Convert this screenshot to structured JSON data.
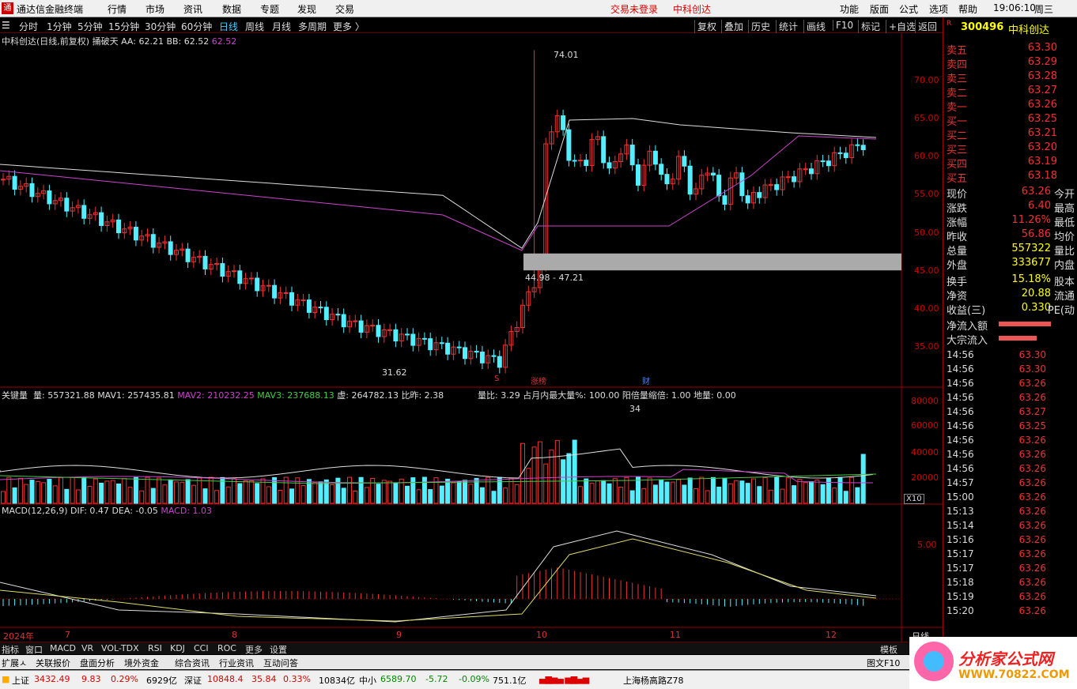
{
  "menu": {
    "app_title": "通达信金融终端",
    "items": [
      "行情",
      "市场",
      "资讯",
      "数据",
      "专题",
      "发现",
      "交易"
    ],
    "login": "交易未登录",
    "stock_name": "中科创达",
    "right_items": [
      "功能",
      "版面",
      "公式",
      "选项",
      "帮助"
    ],
    "time": "19:06:10",
    "weekday": "周三"
  },
  "toolbar": {
    "periods": [
      "分时",
      "1分钟",
      "5分钟",
      "15分钟",
      "30分钟",
      "60分钟",
      "日线",
      "周线",
      "月线",
      "多周期",
      "更多 〉"
    ],
    "active_period": "日线",
    "right_buttons": [
      "复权",
      "叠加",
      "历史",
      "统计",
      "画线",
      "F10",
      "标记",
      "+自选",
      "返回"
    ]
  },
  "main_panel": {
    "title": "中科创达(日线,前复权)",
    "indicator": "捅破天",
    "aa": "AA: 62.21",
    "bb": "BB: 62.52",
    "val": "62.52",
    "y_labels": [
      "70.00",
      "65.00",
      "60.00",
      "55.00",
      "50.00",
      "45.00",
      "40.00",
      "35.00"
    ],
    "high_label": "74.01",
    "low_label": "31.62",
    "gap_label": "44.98 - 47.21",
    "marks": [
      "S",
      "涨榜",
      "财"
    ]
  },
  "volume_panel": {
    "name": "关键量",
    "vol": "量: 557321.88",
    "mav1": "MAV1: 257435.81",
    "mav2": "MAV2: 210232.25",
    "mav3": "MAV3: 237688.13",
    "xu": "虚: 264782.13",
    "bizuo": "比昨: 2.38",
    "liangbi": "量比: 3.29",
    "zhanyue": "占月内最大量%: 100.00",
    "yangbei": "阳倍量缩倍: 1.00",
    "diliang": "地量: 0.00",
    "count": "34",
    "y_labels": [
      "80000",
      "60000",
      "40000",
      "20000"
    ],
    "unit": "X10"
  },
  "macd_panel": {
    "name": "MACD(12,26,9)",
    "dif": "DIF: 0.47",
    "dea": "DEA: -0.05",
    "macd": "MACD: 1.03",
    "y_label": "5.00"
  },
  "xaxis": {
    "labels": [
      "2024年",
      "7",
      "8",
      "9",
      "10",
      "11",
      "12"
    ],
    "period": "日线"
  },
  "quote": {
    "code": "300496",
    "name": "中科创达",
    "sells": [
      [
        "卖五",
        "63.30"
      ],
      [
        "卖四",
        "63.29"
      ],
      [
        "卖三",
        "63.28"
      ],
      [
        "卖二",
        "63.27"
      ],
      [
        "卖一",
        "63.26"
      ]
    ],
    "buys": [
      [
        "买一",
        "63.25"
      ],
      [
        "买二",
        "63.21"
      ],
      [
        "买三",
        "63.20"
      ],
      [
        "买四",
        "63.19"
      ],
      [
        "买五",
        "63.18"
      ]
    ],
    "stats": [
      [
        "现价",
        "63.26",
        "今开"
      ],
      [
        "涨跌",
        "6.40",
        "最高"
      ],
      [
        "涨幅",
        "11.26%",
        "最低"
      ],
      [
        "昨收",
        "56.86",
        "均价"
      ],
      [
        "总量",
        "557322",
        "量比"
      ],
      [
        "外盘",
        "333677",
        "内盘"
      ],
      [
        "换手",
        "15.18%",
        "股本"
      ],
      [
        "净资",
        "20.88",
        "流通"
      ],
      [
        "收益(三)",
        "0.330",
        "PE(动"
      ]
    ],
    "flows": [
      "净流入额",
      "大宗流入"
    ],
    "ticks": [
      [
        "14:56",
        "63.30"
      ],
      [
        "14:56",
        "63.30"
      ],
      [
        "14:56",
        "63.26"
      ],
      [
        "14:56",
        "63.26"
      ],
      [
        "14:56",
        "63.27"
      ],
      [
        "14:56",
        "63.25"
      ],
      [
        "14:56",
        "63.26"
      ],
      [
        "14:56",
        "63.26"
      ],
      [
        "14:56",
        "63.26"
      ],
      [
        "14:57",
        "63.26"
      ],
      [
        "15:00",
        "63.26"
      ],
      [
        "15:13",
        "63.26"
      ],
      [
        "15:14",
        "63.26"
      ],
      [
        "15:16",
        "63.26"
      ],
      [
        "15:17",
        "63.26"
      ],
      [
        "15:17",
        "63.26"
      ],
      [
        "15:18",
        "63.26"
      ],
      [
        "15:19",
        "63.26"
      ],
      [
        "15:20",
        "63.26"
      ]
    ]
  },
  "bottom_tabs": [
    "指标",
    "窗口",
    "MACD",
    "VR",
    "VOL-TDX",
    "RSI",
    "KDJ",
    "CCI",
    "ROC",
    "更多",
    "设置"
  ],
  "template_btn": "模板",
  "bottom_tabs2": [
    "扩展ㅅ",
    "关联报价",
    "盘面分析",
    "境外资金",
    "综合资讯",
    "行业资讯",
    "互动问答"
  ],
  "f10_btn": "图文F10",
  "status": {
    "sh_name": "上证",
    "sh_val": "3432.49",
    "sh_chg": "9.83",
    "sh_pct": "0.29%",
    "sh_amt": "6929亿",
    "sz_name": "深证",
    "sz_val": "10848.4",
    "sz_chg": "35.84",
    "sz_pct": "0.33%",
    "sz_amt": "10834亿",
    "zx_name": "中小",
    "zx_val": "6589.70",
    "zx_chg": "-5.72",
    "zx_pct": "-0.09%",
    "zx_amt": "751.1亿",
    "server": "上海杨高路Z78"
  },
  "brand": {
    "name": "分析家公式网",
    "url": "WWW.70822.COM"
  }
}
